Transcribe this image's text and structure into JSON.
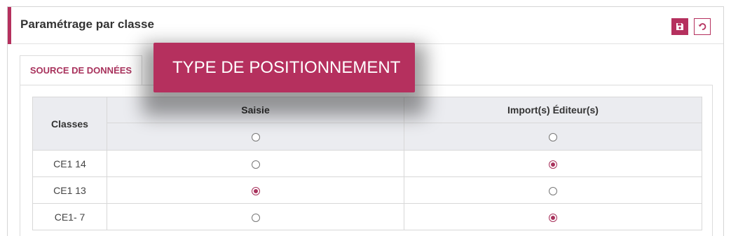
{
  "header": {
    "title": "Paramétrage par classe"
  },
  "tabs": {
    "active_label": "SOURCE DE DONNÉES"
  },
  "table": {
    "columns": {
      "classes": "Classes",
      "saisie": "Saisie",
      "import": "Import(s) Éditeur(s)"
    },
    "rows": [
      {
        "name": "CE1 14",
        "selected": "import"
      },
      {
        "name": "CE1 13",
        "selected": "saisie"
      },
      {
        "name": "CE1- 7",
        "selected": "import"
      }
    ]
  },
  "tooltip": {
    "text": "TYPE DE POSITIONNEMENT"
  },
  "colors": {
    "accent": "#b5305e"
  },
  "icons": {
    "save": "floppy-disk-icon",
    "reset": "undo-icon"
  }
}
